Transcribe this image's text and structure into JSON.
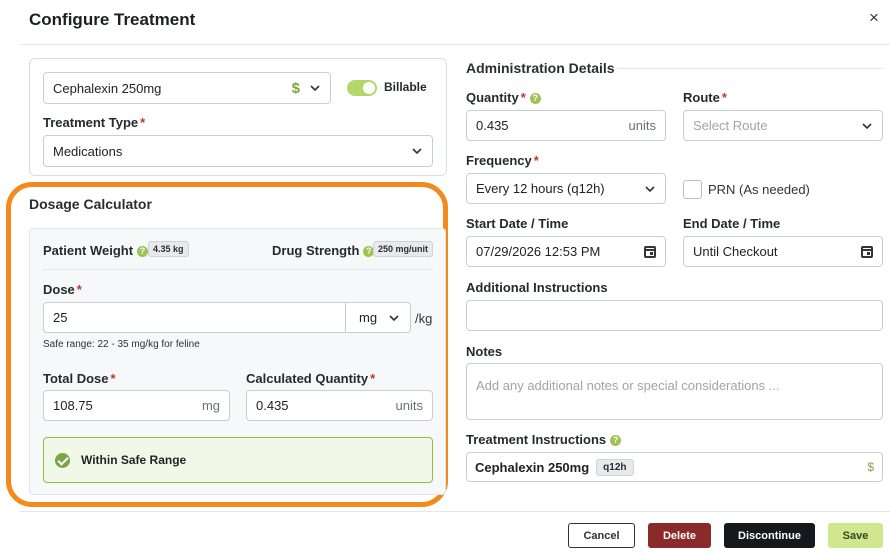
{
  "header": {
    "title": "Configure Treatment",
    "close_glyph": "×"
  },
  "treatment": {
    "product_value": "Cephalexin 250mg",
    "price_glyph": "$",
    "billable_label": "Billable",
    "type_label": "Treatment Type",
    "type_value": "Medications",
    "required_mark": "*"
  },
  "calculator": {
    "title": "Dosage Calculator",
    "patient_weight_label": "Patient Weight",
    "patient_weight_value": "4.35 kg",
    "drug_strength_label": "Drug Strength",
    "drug_strength_value": "250 mg/unit",
    "dose_label": "Dose",
    "dose_value": "25",
    "dose_unit": "mg",
    "dose_per": "/kg",
    "safe_range_text": "Safe range: 22 - 35 mg/kg for feline",
    "total_dose_label": "Total Dose",
    "total_dose_value": "108.75",
    "total_dose_unit": "mg",
    "calc_qty_label": "Calculated Quantity",
    "calc_qty_value": "0.435",
    "calc_qty_unit": "units",
    "status_text": "Within Safe Range"
  },
  "admin": {
    "title": "Administration Details",
    "quantity_label": "Quantity",
    "quantity_value": "0.435",
    "quantity_unit": "units",
    "route_label": "Route",
    "route_placeholder": "Select Route",
    "frequency_label": "Frequency",
    "frequency_value": "Every 12 hours (q12h)",
    "prn_label": "PRN (As needed)",
    "start_label": "Start Date / Time",
    "start_value": "07/29/2026 12:53 PM",
    "end_label": "End Date / Time",
    "end_value": "Until Checkout",
    "additional_label": "Additional Instructions",
    "notes_label": "Notes",
    "notes_placeholder": "Add any additional notes or special considerations ...",
    "instructions_label": "Treatment Instructions",
    "instructions_drug": "Cephalexin 250mg",
    "instructions_freq": "q12h",
    "instructions_price_glyph": "$"
  },
  "footer": {
    "cancel_label": "Cancel",
    "delete_label": "Delete",
    "discontinue_label": "Discontinue",
    "save_label": "Save"
  },
  "colors": {
    "accent_green": "#9dc451",
    "highlight_orange": "#f28a1c",
    "danger_red": "#8b2a2a"
  }
}
